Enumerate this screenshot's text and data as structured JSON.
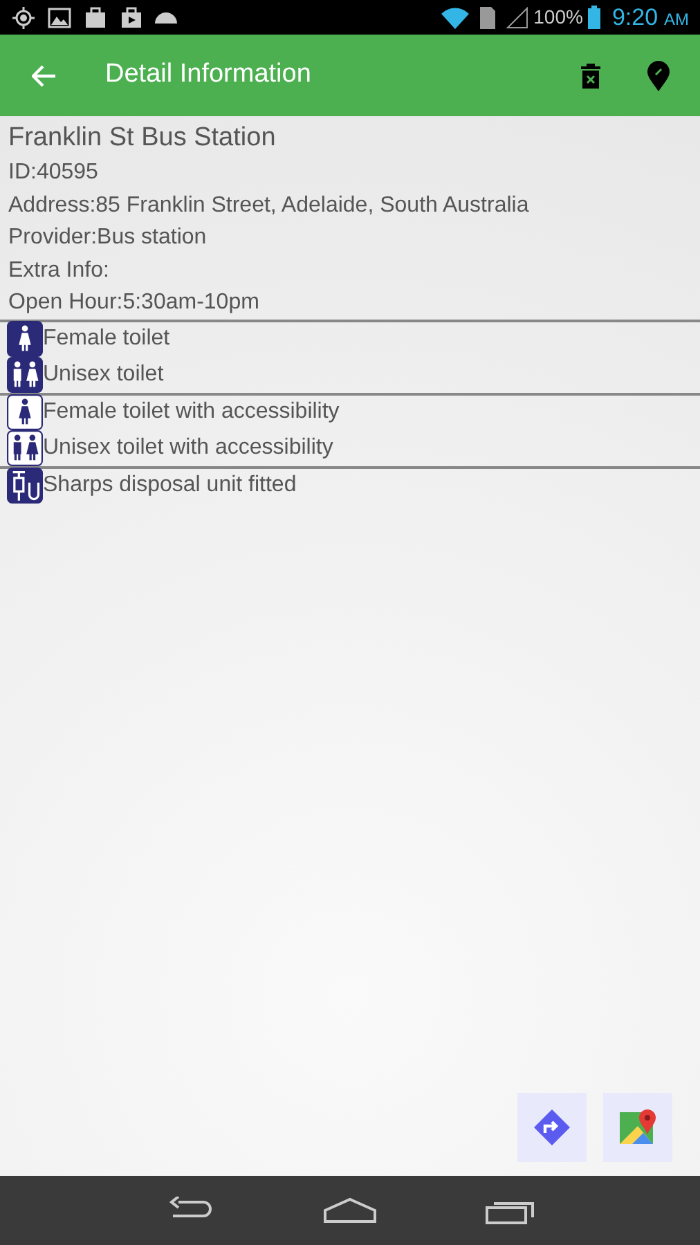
{
  "status_bar": {
    "battery": "100%",
    "time": "9:20",
    "ampm": "AM"
  },
  "app_bar": {
    "title": "Detail Information"
  },
  "details": {
    "name": "Franklin St Bus Station",
    "lines": [
      "ID:40595",
      "Address:85 Franklin Street, Adelaide, South Australia",
      "Provider:Bus station",
      "Extra Info:",
      "Open Hour:5:30am-10pm"
    ]
  },
  "facility_groups": [
    {
      "items": [
        {
          "kind": "female",
          "accessible": false,
          "label": "Female toilet"
        },
        {
          "kind": "unisex",
          "accessible": false,
          "label": "Unisex toilet"
        }
      ]
    },
    {
      "items": [
        {
          "kind": "female",
          "accessible": true,
          "label": "Female toilet with accessibility"
        },
        {
          "kind": "unisex",
          "accessible": true,
          "label": "Unisex toilet with accessibility"
        }
      ]
    },
    {
      "items": [
        {
          "kind": "sharps",
          "accessible": false,
          "label": "Sharps disposal unit fitted"
        }
      ]
    }
  ]
}
